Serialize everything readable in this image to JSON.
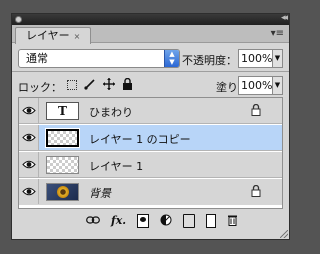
{
  "panel": {
    "tab_label": "レイヤー",
    "tab_close": "×",
    "collapse_glyph": "◂◂",
    "menu_glyph": "▾≡"
  },
  "blend": {
    "value": "通常"
  },
  "opacity": {
    "label": "不透明度：",
    "value": "100%"
  },
  "lock": {
    "label": "ロック："
  },
  "fill": {
    "label": "塗り：",
    "value": "100%"
  },
  "layers": [
    {
      "name": "ひまわり",
      "thumb": "T",
      "type": "text",
      "locked": true,
      "selected": false
    },
    {
      "name": "レイヤー 1 のコピー",
      "type": "empty",
      "locked": false,
      "selected": true
    },
    {
      "name": "レイヤー 1",
      "type": "empty",
      "locked": false,
      "selected": false
    },
    {
      "name": "背景",
      "type": "image",
      "locked": true,
      "selected": false,
      "italic": true
    }
  ],
  "bottom": {
    "fx_label": "fx."
  },
  "colors": {
    "selection": "#b8d5f8",
    "panel": "#d6d6d6",
    "background": "#545454"
  }
}
